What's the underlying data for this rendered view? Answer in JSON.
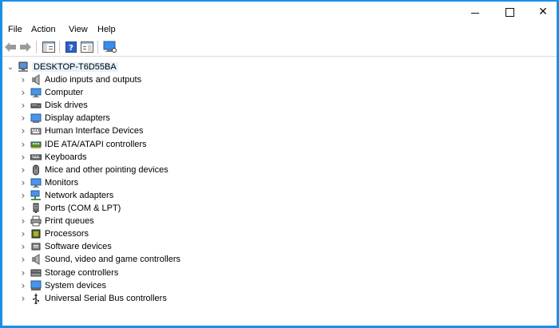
{
  "menu": [
    {
      "label": "File"
    },
    {
      "label": "Action"
    },
    {
      "label": "View"
    },
    {
      "label": "Help"
    }
  ],
  "tree": {
    "root": {
      "label": "DESKTOP-T6D55BA",
      "icon": "computer-icon"
    },
    "categories": [
      {
        "label": "Audio inputs and outputs",
        "icon": "speaker-icon"
      },
      {
        "label": "Computer",
        "icon": "monitor-icon"
      },
      {
        "label": "Disk drives",
        "icon": "disk-drive-icon"
      },
      {
        "label": "Display adapters",
        "icon": "display-adapter-icon"
      },
      {
        "label": "Human Interface Devices",
        "icon": "hid-icon"
      },
      {
        "label": "IDE ATA/ATAPI controllers",
        "icon": "ide-controller-icon"
      },
      {
        "label": "Keyboards",
        "icon": "keyboard-icon"
      },
      {
        "label": "Mice and other pointing devices",
        "icon": "mouse-icon"
      },
      {
        "label": "Monitors",
        "icon": "monitor-icon"
      },
      {
        "label": "Network adapters",
        "icon": "network-adapter-icon"
      },
      {
        "label": "Ports (COM & LPT)",
        "icon": "port-icon"
      },
      {
        "label": "Print queues",
        "icon": "printer-icon"
      },
      {
        "label": "Processors",
        "icon": "processor-icon"
      },
      {
        "label": "Software devices",
        "icon": "software-device-icon"
      },
      {
        "label": "Sound, video and game controllers",
        "icon": "speaker-icon"
      },
      {
        "label": "Storage controllers",
        "icon": "storage-controller-icon"
      },
      {
        "label": "System devices",
        "icon": "system-devices-icon"
      },
      {
        "label": "Universal Serial Bus controllers",
        "icon": "usb-icon"
      }
    ]
  },
  "colors": {
    "accent": "#1a8fe6",
    "selection": "#e5f1fb"
  }
}
